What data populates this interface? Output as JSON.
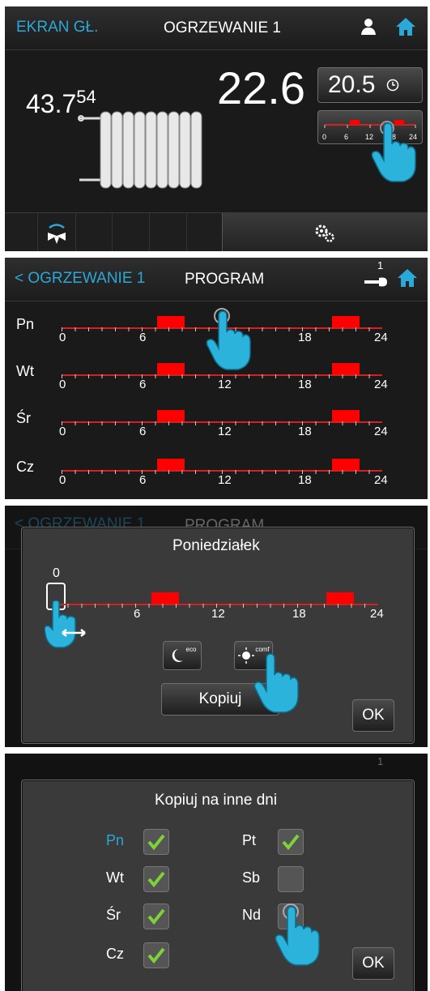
{
  "screen1": {
    "back_label": "EKRAN GŁ.",
    "title": "OGRZEWANIE 1",
    "user_icon": "user-icon",
    "home_icon": "home-icon",
    "current_temp_main": "43.7",
    "current_temp_sup": "54",
    "room_temp": "22.6",
    "set_temp": "20.5",
    "clock_icon": "clock-icon",
    "mini_scale": [
      "0",
      "6",
      "12",
      "18",
      "24"
    ],
    "pump_icon": "pump-icon",
    "settings_icon": "gears-icon"
  },
  "screen2": {
    "back_label": "< OGRZEWANIE 1",
    "title": "PROGRAM",
    "wrench_badge": "1",
    "days": [
      {
        "label": "Pn"
      },
      {
        "label": "Wt"
      },
      {
        "label": "Śr"
      },
      {
        "label": "Cz"
      }
    ],
    "scale": [
      "0",
      "6",
      "12",
      "18",
      "24"
    ]
  },
  "screen3": {
    "bg_back_label": "< OGRZEWANIE 1",
    "bg_title": "PROGRAM",
    "dialog_title": "Poniedziałek",
    "cursor_value": "0",
    "scale": [
      "0",
      "6",
      "12",
      "18",
      "24"
    ],
    "eco_label": "eco",
    "comf_label": "comf",
    "copy_label": "Kopiuj",
    "ok_label": "OK"
  },
  "screen4": {
    "dialog_title": "Kopiuj na inne dni",
    "bg_badge": "1",
    "days_left": [
      {
        "label": "Pn",
        "checked": true
      },
      {
        "label": "Wt",
        "checked": true
      },
      {
        "label": "Śr",
        "checked": true
      },
      {
        "label": "Cz",
        "checked": true
      }
    ],
    "days_right": [
      {
        "label": "Pt",
        "checked": true
      },
      {
        "label": "Sb",
        "checked": false
      },
      {
        "label": "Nd",
        "checked": false
      }
    ],
    "ok_label": "OK"
  },
  "colors": {
    "accent": "#2aa8d8",
    "program_block": "#ff0000",
    "check": "#7dd23a"
  }
}
